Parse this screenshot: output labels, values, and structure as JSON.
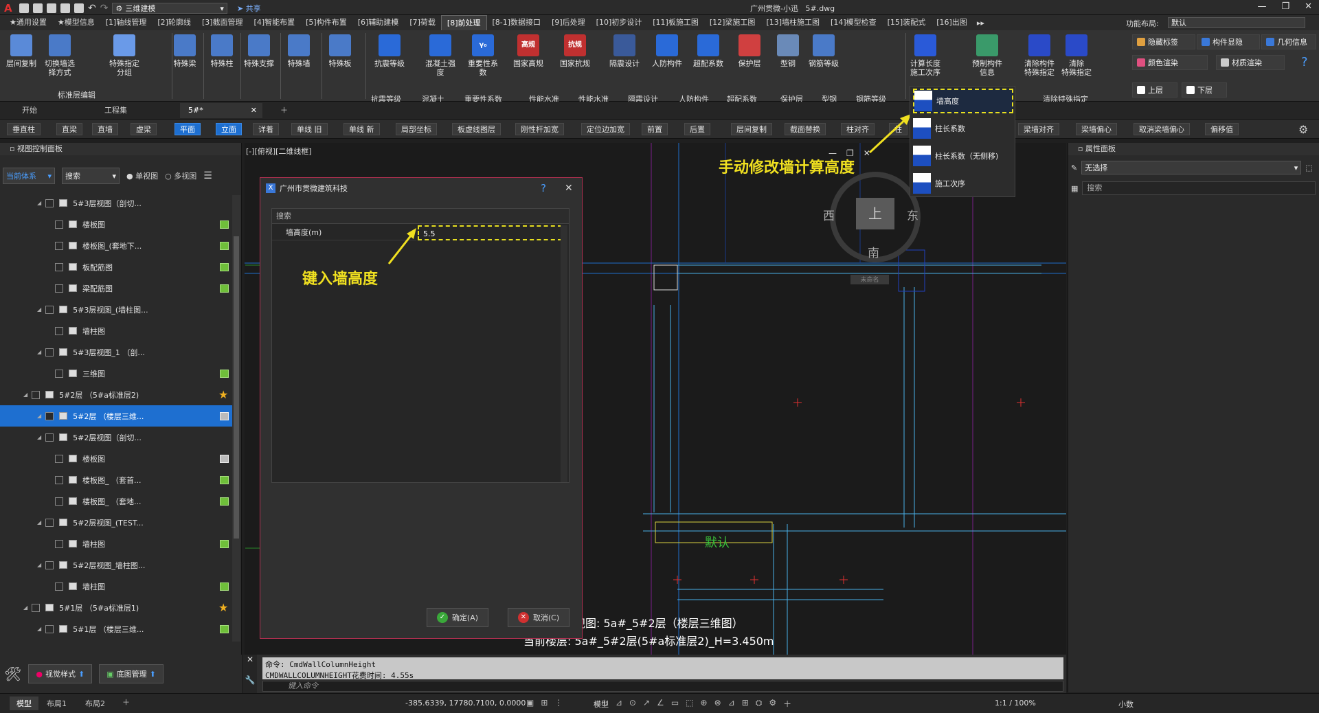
{
  "titlebar": {
    "workspace": "三维建模",
    "share": "共享",
    "app_title": "广州贯微-小迅",
    "file": "5#.dwg"
  },
  "menus": [
    "★通用设置",
    "★模型信息",
    "[1]轴线管理",
    "[2]轮廓线",
    "[3]截面管理",
    "[4]智能布置",
    "[5]构件布置",
    "[6]辅助建模",
    "[7]荷载",
    "[8]前处理",
    "[8-1]数据接口",
    "[9]后处理",
    "[10]初步设计",
    "[11]板施工图",
    "[12]梁施工图",
    "[13]墙柱施工图",
    "[14]模型检查",
    "[15]装配式",
    "[16]出图"
  ],
  "active_menu_index": 9,
  "layout_label": "功能布局:",
  "layout_value": "默认",
  "ribbon": {
    "big": [
      "层间复制",
      "切换墙选择方式",
      "特殊指定分组",
      "特殊梁",
      "特殊柱",
      "特殊支撑",
      "特殊墙",
      "特殊板",
      "抗震等级",
      "混凝土强度",
      "重要性系数",
      "国家高规",
      "国家抗规",
      "隔震设计",
      "人防构件",
      "超配系数",
      "保护层",
      "型钢",
      "钢筋等级",
      "计算长度\n施工次序",
      "预制构件信息",
      "清除构件\n特殊指定",
      "清除\n特殊指定"
    ],
    "group_labels": [
      "标准层编辑",
      "抗震等级",
      "混凝土",
      "重要性系数",
      "性能水准",
      "性能水准",
      "隔震设计",
      "人防构件",
      "超配系数",
      "保护层",
      "型钢",
      "钢筋等级",
      "清除特殊指定"
    ],
    "right_buttons": [
      "隐藏标签",
      "构件显隐",
      "几何信息",
      "颜色渲染",
      "材质渲染",
      "上层",
      "下层"
    ],
    "icon_tags": {
      "gaogui": "高规",
      "kanggui": "抗规",
      "gamma": "γ₀"
    }
  },
  "doc_tabs": [
    "开始",
    "工程集",
    "5#*"
  ],
  "toolstrip": [
    "垂直柱",
    "直梁",
    "直墙",
    "虚梁",
    "平面",
    "立面",
    "详着",
    "单线 旧",
    "单线 新",
    "局部坐标",
    "板虚线图层",
    "刚性杆加宽",
    "定位边加宽",
    "前置",
    "后置",
    "层间复制",
    "截面替换",
    "柱对齐",
    "柱",
    "梁墙对齐",
    "梁墙偏心",
    "取消梁墙偏心",
    "偏移值"
  ],
  "left_panel": {
    "title": "视图控制面板",
    "coord": "当前体系",
    "search": "搜索",
    "single_view": "单视图",
    "multi_view": "多视图",
    "tree": [
      {
        "label": "5#3层视图（剖切...",
        "indent": 1,
        "mark": ""
      },
      {
        "label": "楼板图",
        "indent": 2,
        "mark": "green"
      },
      {
        "label": "楼板图_(套地下...",
        "indent": 2,
        "mark": "green"
      },
      {
        "label": "板配筋图",
        "indent": 2,
        "mark": "green"
      },
      {
        "label": "梁配筋图",
        "indent": 2,
        "mark": "green"
      },
      {
        "label": "5#3层视图_(墙柱图...",
        "indent": 1,
        "mark": ""
      },
      {
        "label": "墙柱图",
        "indent": 2,
        "mark": ""
      },
      {
        "label": "5#3层视图_1 （剖...",
        "indent": 1,
        "mark": ""
      },
      {
        "label": "三维图",
        "indent": 2,
        "mark": "green"
      },
      {
        "label": "5#2层 （5#a标准层2)",
        "indent": 0,
        "mark": "star"
      },
      {
        "label": "5#2层 （楼层三维...",
        "indent": 1,
        "mark": "gray",
        "selected": true
      },
      {
        "label": "5#2层视图（剖切...",
        "indent": 1,
        "mark": ""
      },
      {
        "label": "楼板图",
        "indent": 2,
        "mark": "gray"
      },
      {
        "label": "楼板图_ （套首...",
        "indent": 2,
        "mark": "green"
      },
      {
        "label": "楼板图_ （套地...",
        "indent": 2,
        "mark": "green"
      },
      {
        "label": "5#2层视图_(TEST...",
        "indent": 1,
        "mark": ""
      },
      {
        "label": "墙柱图",
        "indent": 2,
        "mark": "green"
      },
      {
        "label": "5#2层视图_墙柱图...",
        "indent": 1,
        "mark": ""
      },
      {
        "label": "墙柱图",
        "indent": 2,
        "mark": "green"
      },
      {
        "label": "5#1层 （5#a标准层1)",
        "indent": 0,
        "mark": "star"
      },
      {
        "label": "5#1层 （楼层三维...",
        "indent": 1,
        "mark": "green"
      }
    ],
    "bottom_buttons": [
      "视觉样式",
      "底图管理"
    ]
  },
  "canvas": {
    "view_label": "[-][俯视][二维线框]",
    "default_text": "默认",
    "view_info": "视图:  5a#_5#2层（楼层三维图）",
    "layer_info": "当前楼层:  5a#_5#2层(5#a标准层2)_H=3.450m",
    "compass": {
      "w": "西",
      "e": "东",
      "s": "南",
      "top": "上",
      "unnamed": "未命名"
    }
  },
  "dialog": {
    "title": "广州市贯微建筑科技",
    "search_placeholder": "搜索",
    "field_label": "墙高度(m)",
    "field_value": "5.5",
    "ok": "确定(A)",
    "cancel": "取消(C)"
  },
  "dropdown": [
    "墙高度",
    "柱长系数",
    "柱长系数（无侧移)",
    "施工次序"
  ],
  "annotations": {
    "top": "手动修改墙计算高度",
    "dialog": "键入墙高度"
  },
  "right_panel": {
    "title": "属性面板",
    "select": "无选择",
    "search": "搜索"
  },
  "command": {
    "line1": "命令: CmdWallColumnHeight",
    "line2": "CMDWALLCOLUMNHEIGHT花费时间: 4.55s",
    "placeholder": "键入命令"
  },
  "status": {
    "tabs": [
      "模型",
      "布局1",
      "布局2"
    ],
    "coords": "-385.6339, 17780.7100, 0.0000",
    "model": "模型",
    "scale": "1:1 / 100%",
    "decimal": "小数"
  }
}
